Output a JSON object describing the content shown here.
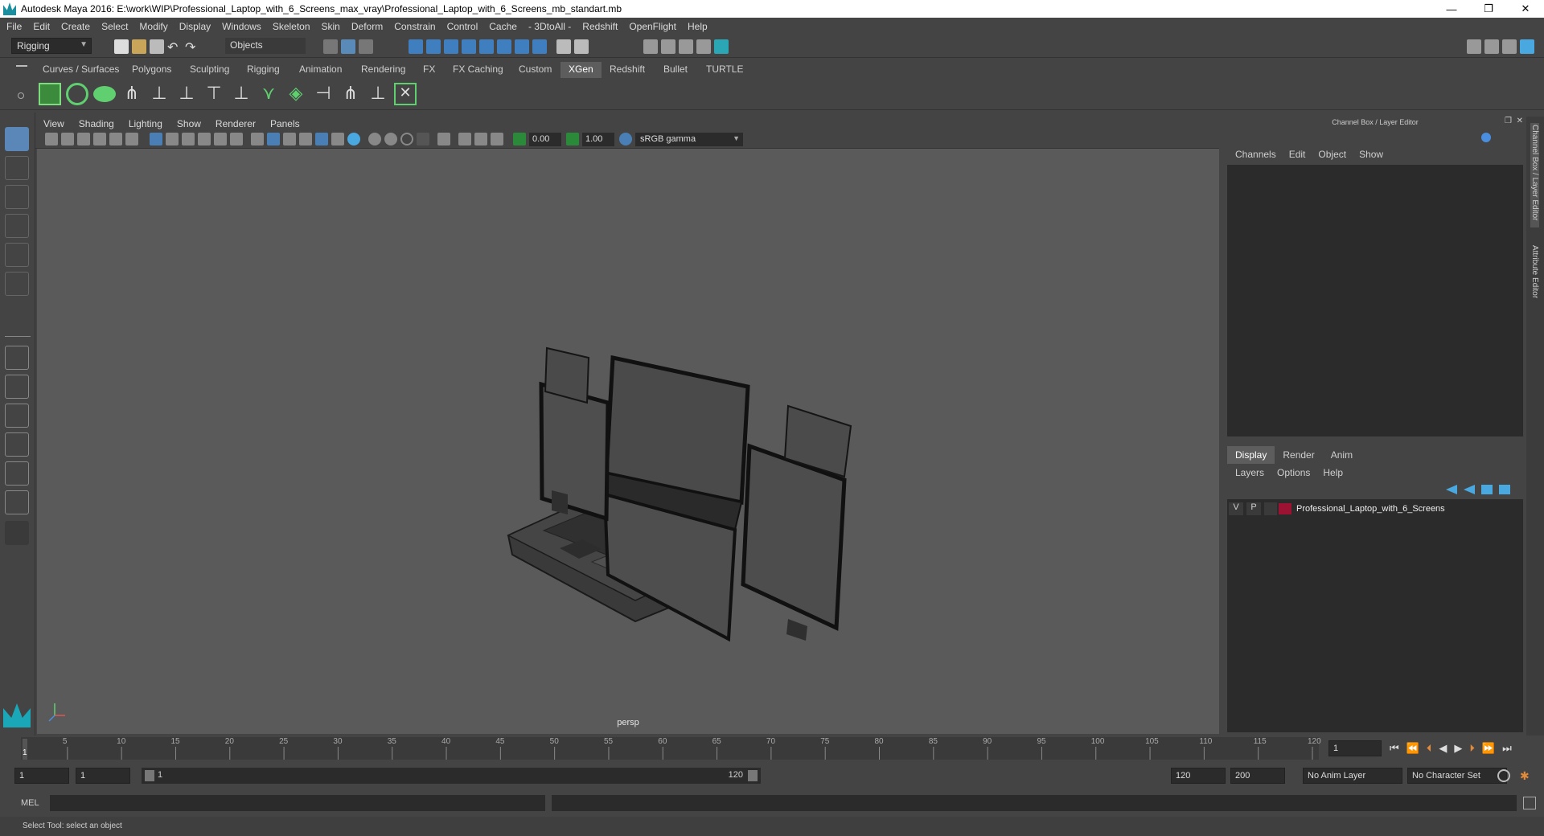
{
  "window": {
    "title": "Autodesk Maya 2016: E:\\work\\WIP\\Professional_Laptop_with_6_Screens_max_vray\\Professional_Laptop_with_6_Screens_mb_standart.mb",
    "minimize": "—",
    "restore": "❐",
    "close": "✕"
  },
  "menubar": [
    "File",
    "Edit",
    "Create",
    "Select",
    "Modify",
    "Display",
    "Windows",
    "Skeleton",
    "Skin",
    "Deform",
    "Constrain",
    "Control",
    "Cache",
    "- 3DtoAll -",
    "Redshift",
    "OpenFlight",
    "Help"
  ],
  "statusline": {
    "menuset": "Rigging",
    "selection_mode": "Objects"
  },
  "shelf_tabs": [
    {
      "label": "Curves / Surfaces",
      "active": false
    },
    {
      "label": "Polygons",
      "active": false
    },
    {
      "label": "Sculpting",
      "active": false
    },
    {
      "label": "Rigging",
      "active": false
    },
    {
      "label": "Animation",
      "active": false
    },
    {
      "label": "Rendering",
      "active": false
    },
    {
      "label": "FX",
      "active": false
    },
    {
      "label": "FX Caching",
      "active": false
    },
    {
      "label": "Custom",
      "active": false
    },
    {
      "label": "XGen",
      "active": true
    },
    {
      "label": "Redshift",
      "active": false
    },
    {
      "label": "Bullet",
      "active": false
    },
    {
      "label": "TURTLE",
      "active": false
    }
  ],
  "viewport": {
    "menu": [
      "View",
      "Shading",
      "Lighting",
      "Show",
      "Renderer",
      "Panels"
    ],
    "exposure": "0.00",
    "gamma": "1.00",
    "colorspace": "sRGB gamma",
    "camera": "persp"
  },
  "channelbox": {
    "title": "Channel Box / Layer Editor",
    "menu": [
      "Channels",
      "Edit",
      "Object",
      "Show"
    ]
  },
  "layer_editor": {
    "tabs": [
      {
        "label": "Display",
        "active": true
      },
      {
        "label": "Render",
        "active": false
      },
      {
        "label": "Anim",
        "active": false
      }
    ],
    "menu": [
      "Layers",
      "Options",
      "Help"
    ],
    "layers": [
      {
        "visible": "V",
        "playback": "P",
        "name": "Professional_Laptop_with_6_Screens",
        "color": "#9b1233"
      }
    ]
  },
  "side_tabs": [
    "Channel Box / Layer Editor",
    "Attribute Editor"
  ],
  "timeline": {
    "ticks": [
      "5",
      "10",
      "15",
      "20",
      "25",
      "30",
      "35",
      "40",
      "45",
      "50",
      "55",
      "60",
      "65",
      "70",
      "75",
      "80",
      "85",
      "90",
      "95",
      "100",
      "105",
      "110",
      "115",
      "120"
    ],
    "start_label": "1",
    "current_frame": "1"
  },
  "range": {
    "start": "1",
    "playback_start": "1",
    "slider_start": "1",
    "slider_end": "120",
    "playback_end": "120",
    "end": "200",
    "anim_layer": "No Anim Layer",
    "character_set": "No Character Set"
  },
  "cmdline": {
    "label": "MEL"
  },
  "helpline": {
    "text": "Select Tool: select an object"
  },
  "colors": {
    "accent_green": "#5fcf6f",
    "accent_blue": "#4aa8e0",
    "active_tab": "#5d5d5d"
  }
}
